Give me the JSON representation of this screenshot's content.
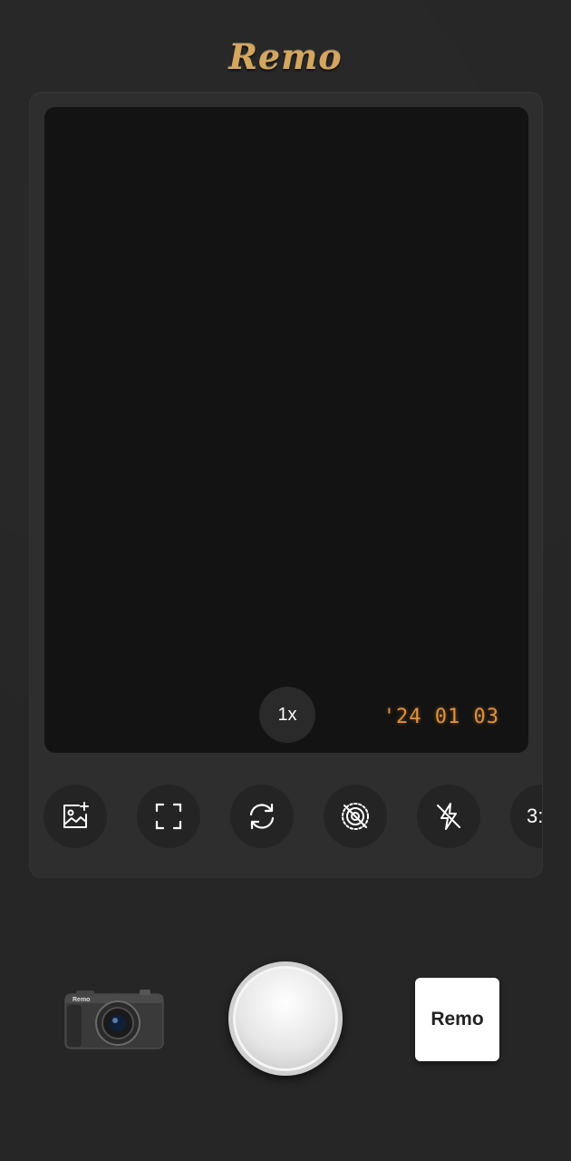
{
  "header": {
    "logo_text": "Remo"
  },
  "viewfinder": {
    "zoom_label": "1x",
    "date_stamp": "'24 01 03"
  },
  "toolbar": {
    "items": [
      {
        "icon": "add-image-icon"
      },
      {
        "icon": "frame-icon"
      },
      {
        "icon": "switch-camera-icon"
      },
      {
        "icon": "timer-off-icon"
      },
      {
        "icon": "flash-off-icon"
      },
      {
        "label": "3:"
      }
    ]
  },
  "bottom": {
    "camera_label": "Remo",
    "preview_label": "Remo"
  },
  "colors": {
    "accent": "#d4a65e",
    "date_stamp": "#e0913a",
    "background": "#262626"
  }
}
